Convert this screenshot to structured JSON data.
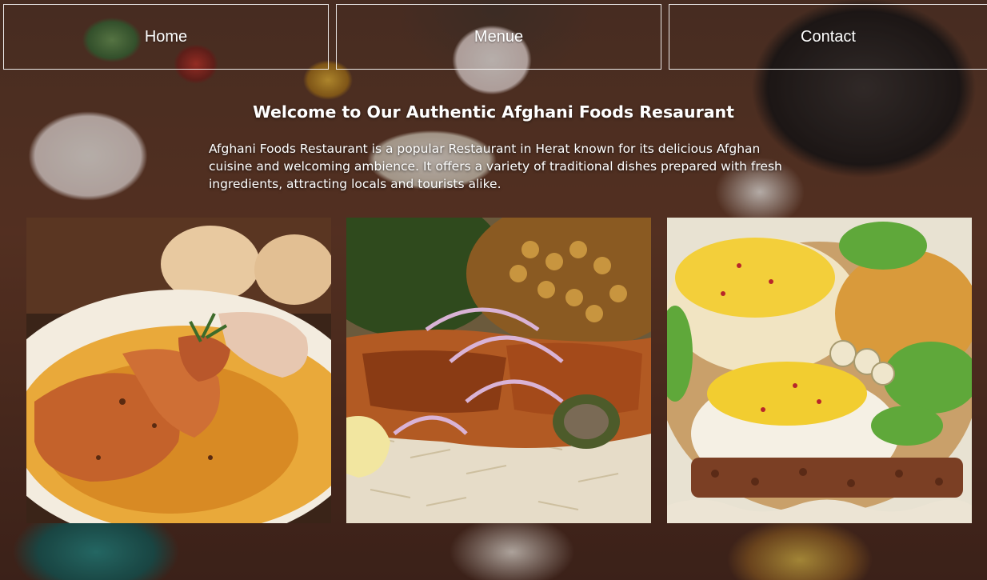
{
  "nav": {
    "items": [
      {
        "label": "Home"
      },
      {
        "label": "Menue"
      },
      {
        "label": "Contact"
      }
    ]
  },
  "hero": {
    "title": "Welcome to Our Authentic Afghani Foods Resaurant",
    "description": "Afghani Foods Restaurant is a popular Restaurant in Herat known for its delicious Afghan cuisine and welcoming ambience. It offers a variety of traditional dishes prepared with fresh ingredients, attracting locals and tourists alike."
  },
  "gallery": {
    "images": [
      {
        "subject": "grilled shrimp in sauce with bread rolls"
      },
      {
        "subject": "kebab over rice with onions, spinach and chickpeas"
      },
      {
        "subject": "saffron rice platter with kebab and salad"
      }
    ]
  }
}
